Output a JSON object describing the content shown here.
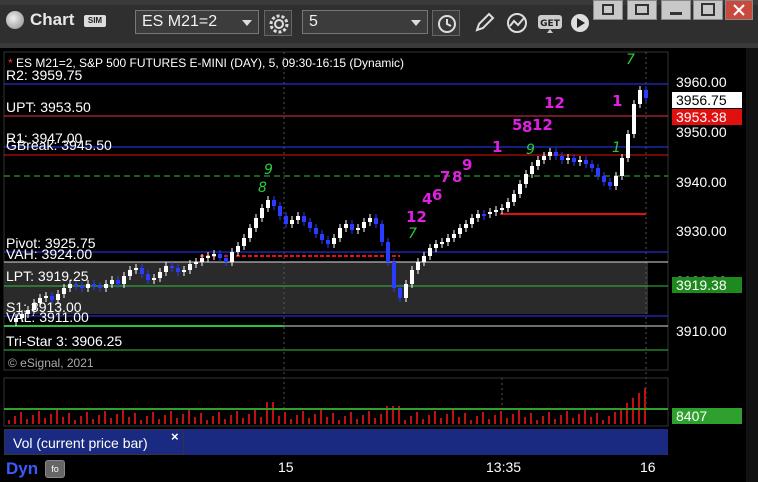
{
  "window": {
    "title": "Chart",
    "sim_badge": "SIM"
  },
  "toolbar": {
    "symbol": "ES M21=2",
    "interval": "5",
    "tools": [
      "gear-icon",
      "clock-icon",
      "pencil-icon",
      "study-icon",
      "get-icon",
      "play-icon"
    ]
  },
  "chart": {
    "info_line": "ES M21=2, S&P 500 FUTURES E-MINI (DAY), 5, 09:30-16:15 (Dynamic)",
    "info_marker": "*",
    "copyright": "© eSignal, 2021",
    "levels": [
      {
        "label": "R2: 3959.75",
        "color": "#2a3cff"
      },
      {
        "label": "UPT: 3953.50",
        "color": "#e03050"
      },
      {
        "label": "R1: 3947.00",
        "color": "#2a3cff"
      },
      {
        "label": "GBreak: 3945.50",
        "color": "#e01010"
      },
      {
        "label": "Pivot: 3925.75",
        "color": "#2a3cff"
      },
      {
        "label": "VAH: 3924.00",
        "color": "#e0e0e0"
      },
      {
        "label": "LPT: 3919.25",
        "color": "#30c040"
      },
      {
        "label": "S1: 3913.00",
        "color": "#2a3cff"
      },
      {
        "label": "VAL: 3911.00",
        "color": "#e0e0e0"
      },
      {
        "label": "Tri-Star 3: 3906.25",
        "color": "#30c040"
      }
    ],
    "y_axis": [
      "3960.00",
      "3950.00",
      "3940.00",
      "3930.00",
      "3920.00",
      "3910.00"
    ],
    "price_boxes": [
      {
        "value": "3956.75",
        "bg": "#ffffff",
        "fg": "#000000"
      },
      {
        "value": "3953.38",
        "bg": "#e01010",
        "fg": "#ffffff"
      },
      {
        "value": "3919.38",
        "bg": "#1e8a1e",
        "fg": "#ffffff"
      }
    ],
    "x_axis": [
      "15",
      "13:35",
      "16"
    ],
    "annotations_magenta": [
      "12",
      "4",
      "6",
      "7",
      "8",
      "9",
      "12",
      "1",
      "5",
      "8",
      "12",
      "1"
    ],
    "annotations_green": [
      "9",
      "8",
      "7",
      "9",
      "7",
      "1"
    ]
  },
  "volume": {
    "label": "Vol (current price bar)",
    "close_glyph": "×",
    "value": "8407"
  },
  "status": {
    "mode": "Dyn",
    "mode_button": "fo"
  },
  "colors": {
    "up_bar": "#ffffff",
    "down_bar": "#2a3cff",
    "volume_bar": "#c01010",
    "magenta": "#e020e0",
    "green": "#2bcc3a"
  }
}
